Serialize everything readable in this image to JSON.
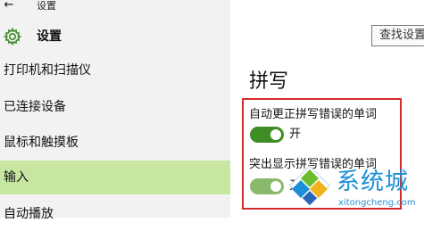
{
  "window": {
    "title": "设置",
    "back_icon": "back-arrow-icon"
  },
  "header": {
    "icon": "gear-icon",
    "title": "设置",
    "search_label": "查找设置"
  },
  "sidebar": {
    "items": [
      {
        "label": "打印机和扫描仪",
        "active": false
      },
      {
        "label": "已连接设备",
        "active": false
      },
      {
        "label": "鼠标和触摸板",
        "active": false
      },
      {
        "label": "输入",
        "active": true
      },
      {
        "label": "自动播放",
        "active": false
      }
    ]
  },
  "main": {
    "title": "拼写",
    "settings": [
      {
        "label": "自动更正拼写错误的单词",
        "state": "开",
        "on": true
      },
      {
        "label": "突出显示拼写错误的单词",
        "state": "开",
        "on": true
      }
    ]
  },
  "watermark": {
    "text": "系统城",
    "url": "xitongcheng.com"
  },
  "colors": {
    "sidebar_bg": "#f2f2f2",
    "active_item_bg": "#c7e6a2",
    "toggle_on": "#3f8d25",
    "highlight_border": "#d12b2b",
    "watermark_blue": "#1a8fd8"
  }
}
